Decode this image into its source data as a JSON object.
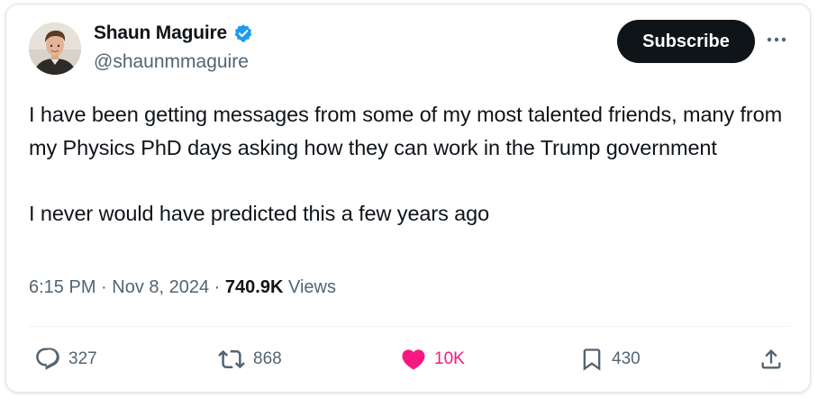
{
  "author": {
    "display_name": "Shaun Maguire",
    "handle": "@shaunmmaguire",
    "verified": true
  },
  "subscribe_label": "Subscribe",
  "tweet": {
    "line1": "I have been getting messages from some of my most talented friends, many from my Physics PhD days asking how they can work in the Trump government",
    "line2": "I never would have predicted this a few years ago"
  },
  "meta": {
    "time": "6:15 PM",
    "sep1": " · ",
    "date": "Nov 8, 2024",
    "sep2": " · ",
    "views_count": "740.9K",
    "views_label": " Views"
  },
  "actions": {
    "replies": "327",
    "reposts": "868",
    "likes": "10K",
    "bookmarks": "430"
  },
  "colors": {
    "text": "#0f1419",
    "secondary": "#536471",
    "verified": "#1d9bf0",
    "like": "#f91880",
    "button_bg": "#0f1419"
  },
  "icons": [
    "verified-badge-icon",
    "more-icon",
    "reply-icon",
    "repost-icon",
    "heart-icon",
    "bookmark-icon",
    "share-icon"
  ]
}
